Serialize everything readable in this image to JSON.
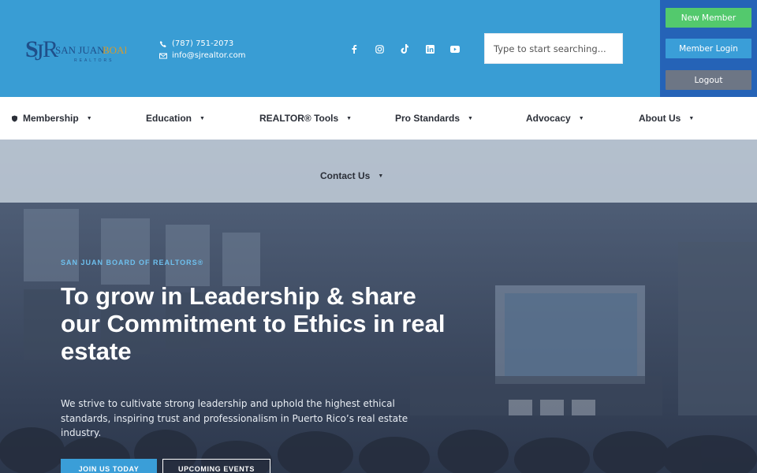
{
  "brand": {
    "logo_text": "SJBR",
    "logo_name": "SAN JUAN BOARD",
    "logo_sub": "REALTORS"
  },
  "contact": {
    "phone": "(787) 751-2073",
    "email": "info@sjrealtor.com"
  },
  "social": [
    "facebook-icon",
    "instagram-icon",
    "tiktok-icon",
    "linkedin-icon",
    "youtube-icon"
  ],
  "search": {
    "placeholder": "Type to start searching..."
  },
  "account": {
    "new_member": "New Member",
    "member_login": "Member Login",
    "logout": "Logout"
  },
  "nav": {
    "items": [
      {
        "label": "Membership"
      },
      {
        "label": "Education"
      },
      {
        "label": "REALTOR® Tools"
      },
      {
        "label": "Pro Standards"
      },
      {
        "label": "Advocacy"
      },
      {
        "label": "About Us"
      },
      {
        "label": "Contact Us"
      }
    ]
  },
  "hero": {
    "eyebrow": "SAN JUAN BOARD OF REALTORS®",
    "headline": "To grow in Leadership & share our Commitment to Ethics in real estate",
    "lead": "We strive to cultivate strong leadership and uphold the highest ethical standards, inspiring trust and professionalism in Puerto Rico’s real estate industry.",
    "cta_join": "JOIN US TODAY",
    "cta_events": "UPCOMING EVENTS"
  },
  "colors": {
    "header_bg": "#399dd4",
    "account_bg": "#2563b7",
    "new_member": "#53c96d",
    "login": "#3a9ed8",
    "logout": "#6d7685"
  }
}
